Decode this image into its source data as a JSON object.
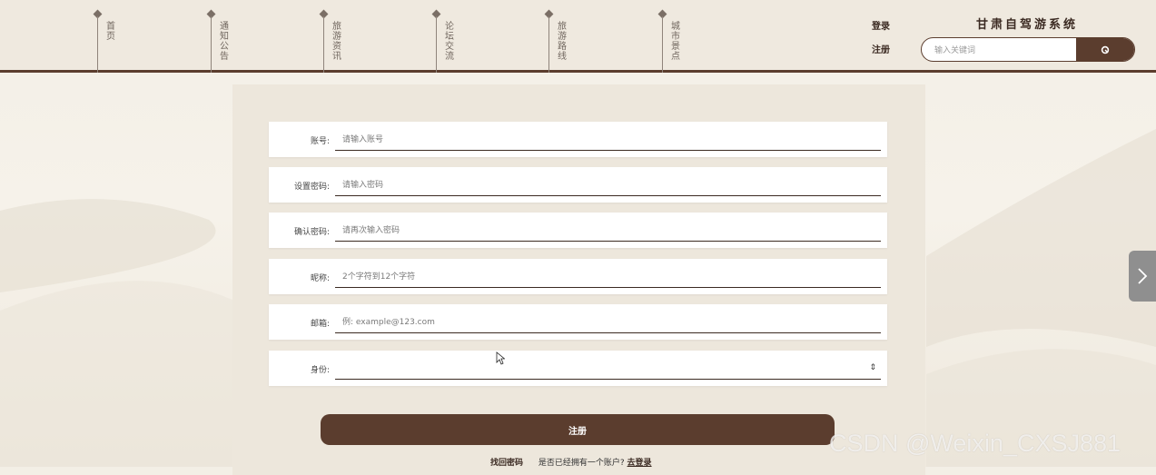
{
  "nav": [
    {
      "label": "首页"
    },
    {
      "label": "通知公告"
    },
    {
      "label": "旅游资讯"
    },
    {
      "label": "论坛交流"
    },
    {
      "label": "旅游路线"
    },
    {
      "label": "城市景点"
    }
  ],
  "auth": {
    "login": "登录",
    "register": "注册"
  },
  "site_title": "甘肃自驾游系统",
  "search": {
    "placeholder": "输入关键词",
    "button_icon": "search-icon"
  },
  "form": {
    "account": {
      "label": "账号:",
      "placeholder": "请输入账号"
    },
    "password": {
      "label": "设置密码:",
      "placeholder": "请输入密码"
    },
    "confirm": {
      "label": "确认密码:",
      "placeholder": "请再次输入密码"
    },
    "nickname": {
      "label": "昵称:",
      "placeholder": "2个字符到12个字符"
    },
    "email": {
      "label": "邮箱:",
      "placeholder": "例: example@123.com"
    },
    "identity": {
      "label": "身份:",
      "value": ""
    },
    "submit_label": "注册"
  },
  "links": {
    "find_password": "找回密码",
    "have_account": "是否已经拥有一个账户?",
    "go_login": "去登录"
  },
  "watermark": "CSDN @Weixin_CXSJ881",
  "colors": {
    "brand": "#5b3d2e",
    "header_bg": "#efe9df",
    "panel_bg": "#ede7dc"
  }
}
